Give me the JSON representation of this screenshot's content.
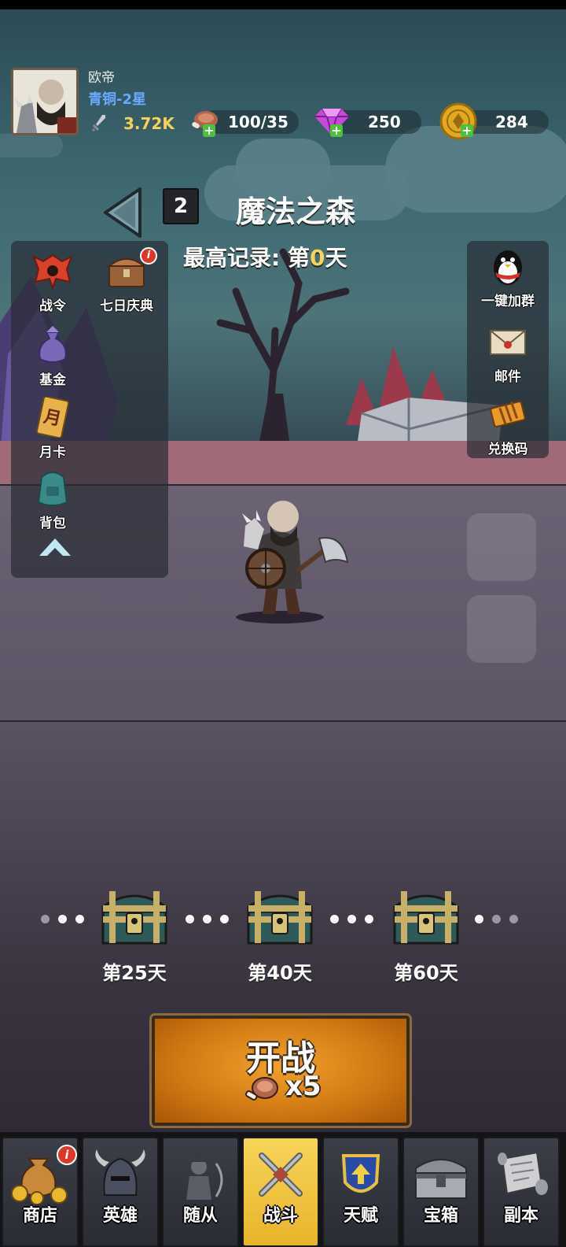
{
  "player": {
    "name": "欧帝",
    "rank": "青铜-2星",
    "power": "3.72K"
  },
  "resources": {
    "stamina": "100/35",
    "gems": "250",
    "gold": "284"
  },
  "level": {
    "number": "2",
    "title": "魔法之森",
    "record_prefix": "最高记录: 第",
    "record_value": "0",
    "record_suffix": "天"
  },
  "left_menu": [
    {
      "label": "战令",
      "icon": "battle-pass-icon"
    },
    {
      "label": "七日庆典",
      "icon": "treasure-chest-icon",
      "badge": "i"
    },
    {
      "label": "基金",
      "icon": "money-bag-icon"
    },
    {
      "label": "月卡",
      "icon": "monthly-card-icon",
      "icon_text": "月"
    },
    {
      "label": "背包",
      "icon": "backpack-icon"
    }
  ],
  "right_menu": [
    {
      "label": "一键加群",
      "icon": "qq-penguin-icon"
    },
    {
      "label": "邮件",
      "icon": "mail-icon"
    },
    {
      "label": "兑换码",
      "icon": "ticket-icon"
    }
  ],
  "milestones": [
    {
      "label": "第25天"
    },
    {
      "label": "第40天"
    },
    {
      "label": "第60天"
    }
  ],
  "start_button": {
    "label": "开战",
    "cost": "x5"
  },
  "bottom_nav": [
    {
      "label": "商店",
      "icon": "shop-bag-icon",
      "badge": "i",
      "active": false
    },
    {
      "label": "英雄",
      "icon": "helmet-icon",
      "active": false
    },
    {
      "label": "随从",
      "icon": "companion-icon",
      "active": false
    },
    {
      "label": "战斗",
      "icon": "crossed-swords-icon",
      "active": true
    },
    {
      "label": "天赋",
      "icon": "talent-shield-icon",
      "active": false
    },
    {
      "label": "宝箱",
      "icon": "chest-icon",
      "active": false
    },
    {
      "label": "副本",
      "icon": "scroll-icon",
      "active": false
    }
  ],
  "colors": {
    "accent_gold": "#f6d25a",
    "rank_blue": "#6aa9ff",
    "active_tab": "#f7d45a",
    "start_button": "#e08a1a"
  }
}
